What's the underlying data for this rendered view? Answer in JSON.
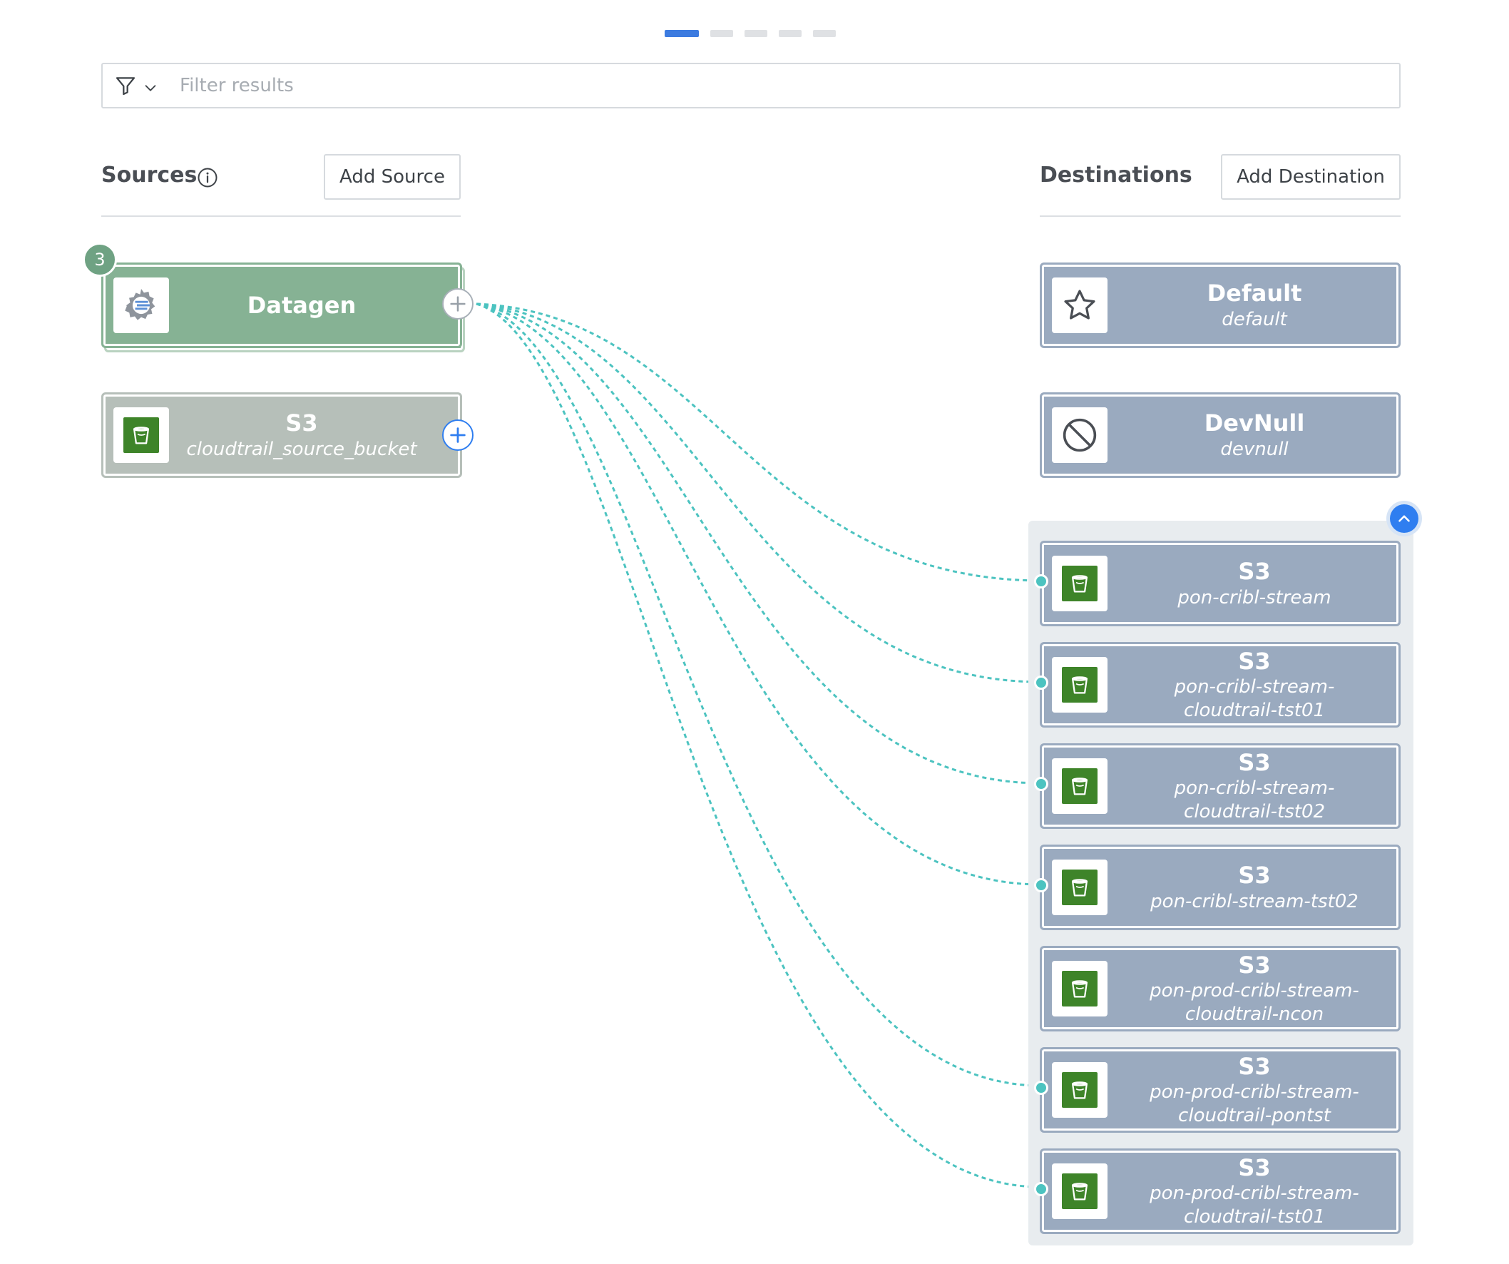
{
  "pager": {
    "active_index": 0,
    "count": 5
  },
  "filter": {
    "placeholder": "Filter results",
    "icon": "filter-icon"
  },
  "sources": {
    "title": "Sources",
    "add_label": "Add Source",
    "items": [
      {
        "title": "Datagen",
        "subtitle": "",
        "icon": "datagen-gear-icon",
        "connection_count": "3"
      },
      {
        "title": "S3",
        "subtitle": "cloudtrail_source_bucket",
        "icon": "s3-bucket-icon"
      }
    ]
  },
  "destinations": {
    "title": "Destinations",
    "add_label": "Add Destination",
    "items": [
      {
        "title": "Default",
        "subtitle": "default",
        "icon": "star-icon"
      },
      {
        "title": "DevNull",
        "subtitle": "devnull",
        "icon": "no-entry-icon"
      }
    ],
    "group": [
      {
        "title": "S3",
        "subtitle": "pon-cribl-stream",
        "icon": "s3-bucket-icon",
        "connected": true
      },
      {
        "title": "S3",
        "subtitle": "pon-cribl-stream-cloudtrail-tst01",
        "icon": "s3-bucket-icon",
        "connected": true
      },
      {
        "title": "S3",
        "subtitle": "pon-cribl-stream-cloudtrail-tst02",
        "icon": "s3-bucket-icon",
        "connected": true
      },
      {
        "title": "S3",
        "subtitle": "pon-cribl-stream-tst02",
        "icon": "s3-bucket-icon",
        "connected": true
      },
      {
        "title": "S3",
        "subtitle": "pon-prod-cribl-stream-cloudtrail-ncon",
        "icon": "s3-bucket-icon",
        "connected": false
      },
      {
        "title": "S3",
        "subtitle": "pon-prod-cribl-stream-cloudtrail-pontst",
        "icon": "s3-bucket-icon",
        "connected": true
      },
      {
        "title": "S3",
        "subtitle": "pon-prod-cribl-stream-cloudtrail-tst01",
        "icon": "s3-bucket-icon",
        "connected": true
      }
    ]
  },
  "colors": {
    "accent": "#3c7be0",
    "source_active": "#86b294",
    "source_inactive": "#b6bfb9",
    "destination": "#9aaabf",
    "connection": "#4cc3c0",
    "s3_icon": "#3e8429"
  }
}
